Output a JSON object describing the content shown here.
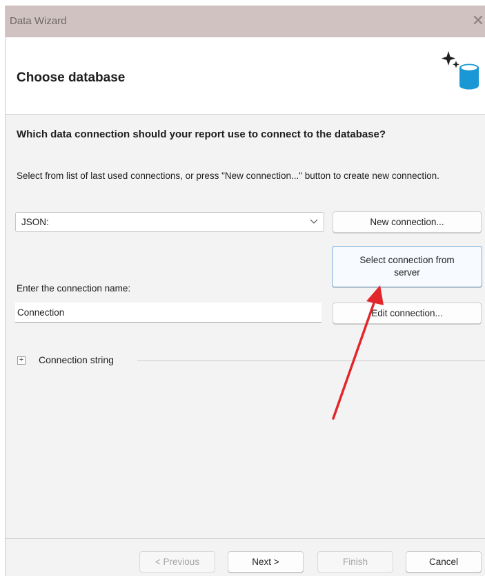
{
  "window": {
    "title": "Data Wizard",
    "close_glyph": "✕"
  },
  "header": {
    "title": "Choose database",
    "icon": "database-sparkle-icon"
  },
  "question": "Which data connection should your report use to connect to the database?",
  "instruction": "Select from list of last used connections, or press \"New connection...\" button to create new connection.",
  "connection_select": {
    "value": "JSON:"
  },
  "buttons": {
    "new_connection": "New connection...",
    "select_from_server": "Select connection from server",
    "edit_connection": "Edit connection..."
  },
  "connection_name": {
    "label": "Enter the connection name:",
    "value": "Connection"
  },
  "expander": {
    "glyph": "+",
    "label": "Connection string"
  },
  "footer": {
    "previous": "< Previous",
    "next": "Next >",
    "finish": "Finish",
    "cancel": "Cancel"
  },
  "colors": {
    "accent_border": "#7aa9d6",
    "annotation_arrow": "#e3262b",
    "titlebar": "#cfc2c1"
  }
}
